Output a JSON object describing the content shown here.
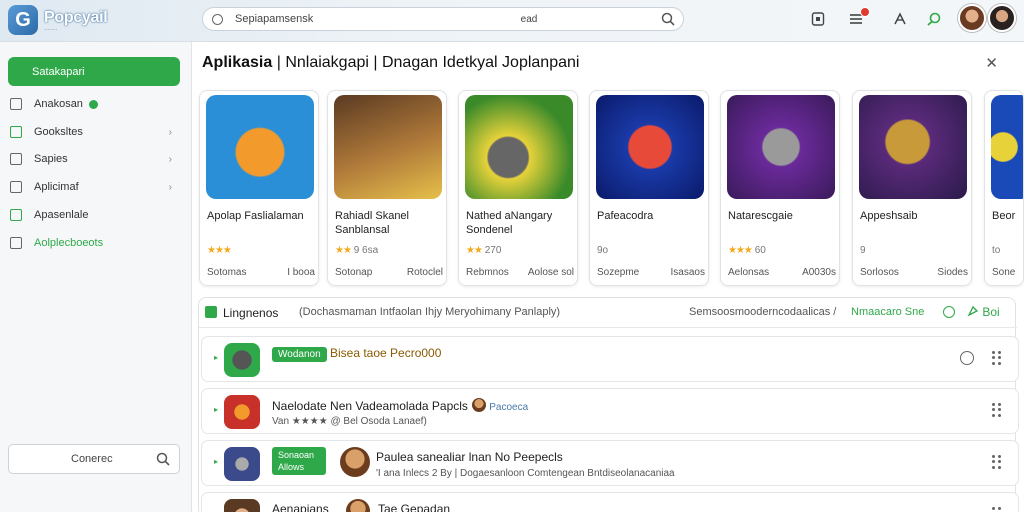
{
  "app": {
    "logo_letter": "G",
    "logo_name": "Popcyail",
    "logo_tagline": "........"
  },
  "search": {
    "query": "Sepiapamsensk",
    "hint": "ead"
  },
  "sidebar": {
    "primary_label": "Satakapari",
    "items": [
      {
        "label": "Anakosan",
        "has_badge": true,
        "chevron": false,
        "active": false
      },
      {
        "label": "Gooksltes",
        "has_badge": false,
        "chevron": true,
        "active": false
      },
      {
        "label": "Sapies",
        "has_badge": false,
        "chevron": true,
        "active": false
      },
      {
        "label": "Aplicimaf",
        "has_badge": false,
        "chevron": true,
        "active": false
      },
      {
        "label": "Apasenlale",
        "has_badge": false,
        "chevron": false,
        "active": false
      },
      {
        "label": "Aolplecboeots",
        "has_badge": false,
        "chevron": false,
        "active": true
      }
    ],
    "bottom_search_label": "Conerec"
  },
  "section": {
    "title_bold": "Aplikasia",
    "title_rest": "| Nnlaiakgapi | Dnagan Idetkyal Joplanpani"
  },
  "cards": [
    {
      "name": "Apolap Faslialaman",
      "rating": "",
      "stars": "★★★",
      "foot_left": "Sotomas",
      "foot_right": "I booa",
      "colors": [
        "#2a8fd6",
        "#f39a2c"
      ]
    },
    {
      "name": "Rahiadl Skanel Sanblansal",
      "rating": "9 6sa",
      "stars": "★★",
      "foot_left": "Sotonap",
      "foot_right": "Rotoclel",
      "colors": [
        "#7a4a2a",
        "#d69a3a"
      ]
    },
    {
      "name": "Nathed aNangary Sondenel",
      "rating": "270",
      "stars": "★★",
      "foot_left": "Rebmnos",
      "foot_right": "Aolose sol",
      "colors": [
        "#3a8a2a",
        "#e6d23a"
      ]
    },
    {
      "name": "Pafeacodra",
      "rating": "9o",
      "stars": "",
      "foot_left": "Sozepme",
      "foot_right": "Isasaos",
      "colors": [
        "#1a3aa8",
        "#e84a3a"
      ]
    },
    {
      "name": "Natarescgaie",
      "rating": "60",
      "stars": "★★★",
      "foot_left": "Aelonsas",
      "foot_right": "A0030s",
      "colors": [
        "#6a2a9a",
        "#aaaaaa"
      ]
    },
    {
      "name": "Appeshsaib",
      "rating": "9",
      "stars": "",
      "foot_left": "Sorlosos",
      "foot_right": "Siodes",
      "colors": [
        "#5a2a7a",
        "#c89a3a"
      ]
    },
    {
      "name": "Beor",
      "rating": "to",
      "stars": "",
      "foot_left": "Sone",
      "foot_right": "",
      "colors": [
        "#1a4ab8",
        "#e8d23a"
      ]
    }
  ],
  "panel": {
    "title": "Lingnenos",
    "subtitle": "(Dochasmaman Intfaolan Ihjy Meryohimany Panlaply)",
    "right_text": "Semsoosmooderncodaalicas  /",
    "link_text": "Nmaacaro  Sne",
    "button_label": "Boi"
  },
  "rows": [
    {
      "pill": "Wodanon",
      "text1": "Bisea taoe  Pecro000",
      "text2": "",
      "has_circle": true
    },
    {
      "pill": "",
      "text1": "Naelodate Nen Vadeamolada Papcls",
      "text1_tag": "Pacoeca",
      "text2": "Van ★★★★  @ Bel Osoda Lanaef)",
      "has_circle": false
    },
    {
      "pill": "Sonaoan Allows",
      "text1": "Paulea sanealiar lnan No Peepecls",
      "text2": "'I ana Inlecs 2 By | Dogaesanloon Comtengean Bntdiseolanacaniaa",
      "has_circle": false
    },
    {
      "pill": "",
      "text1": "Aenapians",
      "text1_b": "Tae Gepadan",
      "text2": "",
      "has_circle": false
    }
  ]
}
